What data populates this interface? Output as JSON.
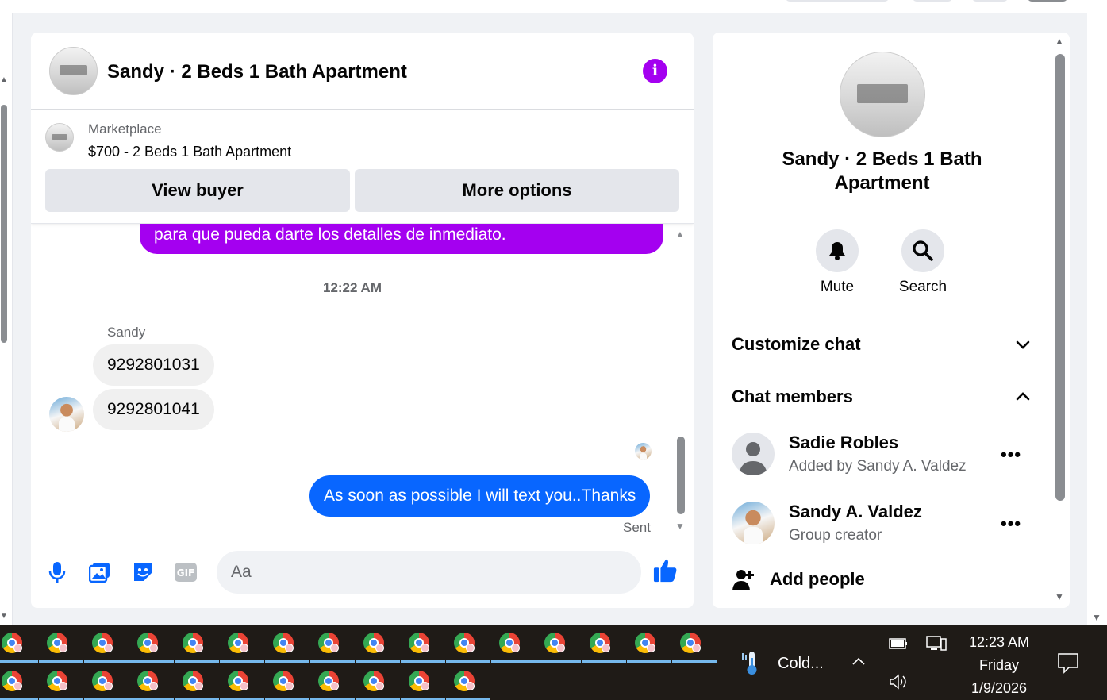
{
  "chat": {
    "title": "Sandy · 2 Beds 1 Bath Apartment",
    "marketplace_label": "Marketplace",
    "listing_title": "$700 - 2 Beds 1 Bath Apartment",
    "view_buyer_label": "View buyer",
    "more_options_label": "More options",
    "messages": {
      "outgoing_purple": "para que pueda darte los detalles de inmediato.",
      "timestamp": "12:22 AM",
      "sender_name": "Sandy",
      "incoming": [
        "9292801031",
        "9292801041"
      ],
      "outgoing_blue": "As soon as possible I will text you..Thanks",
      "status": "Sent"
    },
    "composer": {
      "placeholder": "Aa"
    }
  },
  "info_panel": {
    "title": "Sandy · 2 Beds 1 Bath Apartment",
    "mute_label": "Mute",
    "search_label": "Search",
    "customize_label": "Customize chat",
    "members_label": "Chat members",
    "members": [
      {
        "name": "Sadie Robles",
        "sub": "Added by Sandy A. Valdez"
      },
      {
        "name": "Sandy A. Valdez",
        "sub": "Group creator"
      }
    ],
    "add_people_label": "Add people"
  },
  "taskbar": {
    "weather_text": "Cold...",
    "time": "12:23 AM",
    "day": "Friday",
    "date": "1/9/2026"
  },
  "colors": {
    "accent_purple": "#a400f0",
    "message_blue": "#0866ff",
    "taskbar_bg": "#1f1b17"
  },
  "icons": [
    "info-icon",
    "mic-icon",
    "photo-icon",
    "sticker-icon",
    "gif-icon",
    "emoji-icon",
    "thumbs-up-icon",
    "bell-icon",
    "search-icon",
    "chevron-down-icon",
    "chevron-up-icon",
    "more-dots-icon",
    "add-person-icon",
    "chrome-icon",
    "weather-icon",
    "battery-icon",
    "network-icon",
    "volume-icon",
    "notification-icon"
  ]
}
